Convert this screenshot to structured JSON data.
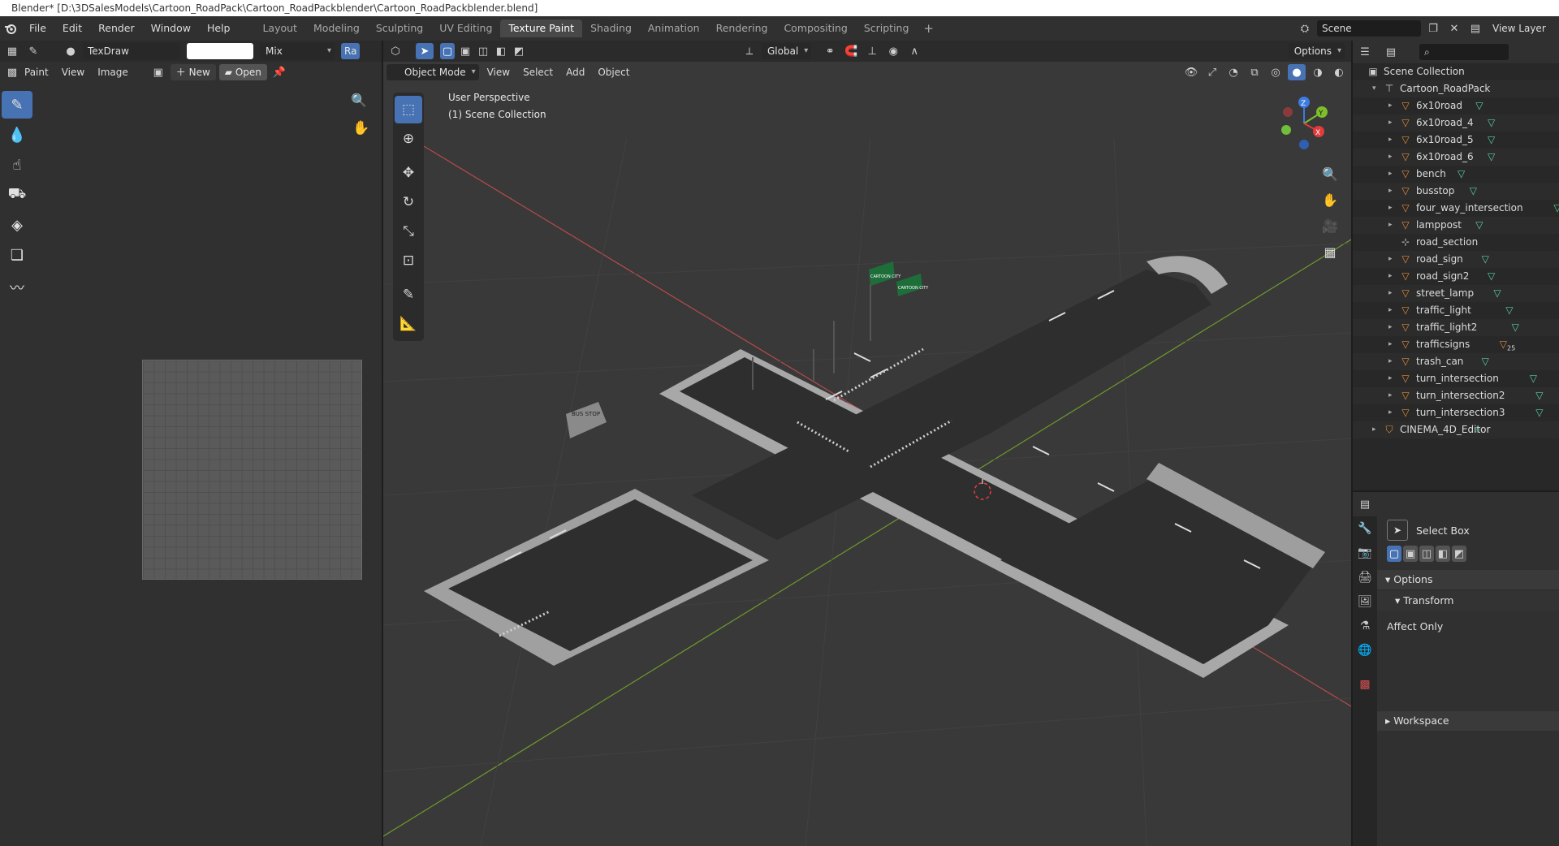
{
  "window": {
    "title": "Blender* [D:\\3DSalesModels\\Cartoon_RoadPack\\Cartoon_RoadPackblender\\Cartoon_RoadPackblender.blend]"
  },
  "menu": [
    "File",
    "Edit",
    "Render",
    "Window",
    "Help"
  ],
  "workspaces": [
    "Layout",
    "Modeling",
    "Sculpting",
    "UV Editing",
    "Texture Paint",
    "Shading",
    "Animation",
    "Rendering",
    "Compositing",
    "Scripting"
  ],
  "active_workspace": "Texture Paint",
  "scene": {
    "name": "Scene",
    "view_layer": "View Layer"
  },
  "image_editor": {
    "brush_name": "TexDraw",
    "blend_mode": "Mix",
    "radius_short": "Ra",
    "paint_menu": "Paint",
    "view_menu": "View",
    "image_menu": "Image",
    "new_label": "New",
    "open_label": "Open"
  },
  "viewport": {
    "orientation": "Global",
    "options_label": "Options",
    "mode": "Object Mode",
    "menus": [
      "View",
      "Select",
      "Add",
      "Object"
    ],
    "info_line1": "User Perspective",
    "info_line2": "(1) Scene Collection",
    "scene_text": {
      "bus_stop": "BUS STOP",
      "sign1": "CARTOON CITY",
      "sign2": "CARTOON CITY"
    }
  },
  "outliner": {
    "root": "Scene Collection",
    "collection": "Cartoon_RoadPack",
    "objects": [
      {
        "name": "6x10road",
        "type": "mesh"
      },
      {
        "name": "6x10road_4",
        "type": "mesh"
      },
      {
        "name": "6x10road_5",
        "type": "mesh"
      },
      {
        "name": "6x10road_6",
        "type": "mesh"
      },
      {
        "name": "bench",
        "type": "mesh"
      },
      {
        "name": "busstop",
        "type": "mesh"
      },
      {
        "name": "four_way_intersection",
        "type": "mesh"
      },
      {
        "name": "lamppost",
        "type": "mesh"
      },
      {
        "name": "road_section",
        "type": "empty"
      },
      {
        "name": "road_sign",
        "type": "mesh"
      },
      {
        "name": "road_sign2",
        "type": "mesh"
      },
      {
        "name": "street_lamp",
        "type": "mesh"
      },
      {
        "name": "traffic_light",
        "type": "mesh"
      },
      {
        "name": "traffic_light2",
        "type": "mesh"
      },
      {
        "name": "trafficsigns",
        "type": "mesh",
        "badge": "25"
      },
      {
        "name": "trash_can",
        "type": "mesh"
      },
      {
        "name": "turn_intersection",
        "type": "mesh"
      },
      {
        "name": "turn_intersection2",
        "type": "mesh"
      },
      {
        "name": "turn_intersection3",
        "type": "mesh"
      }
    ],
    "camera": "CINEMA_4D_Editor"
  },
  "properties": {
    "tool_name": "Select Box",
    "options": "Options",
    "transform": "Transform",
    "affect_only": "Affect Only",
    "workspace": "Workspace"
  },
  "colors": {
    "accent": "#4772b3",
    "x_axis": "#e23b3b",
    "y_axis": "#7fbf2a",
    "z_axis": "#3b7be2"
  }
}
